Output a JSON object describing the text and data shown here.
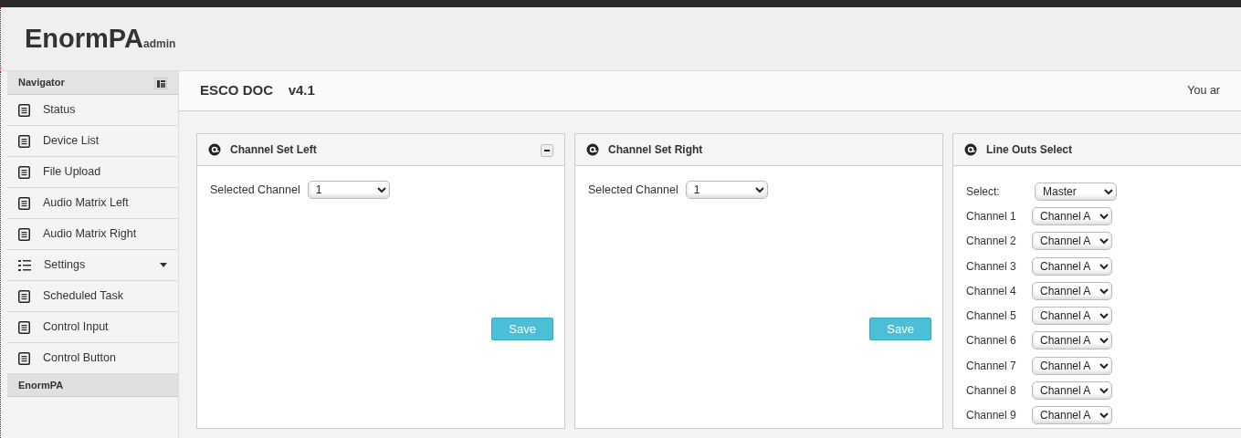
{
  "brand": {
    "name": "EnormPA",
    "suffix": "admin"
  },
  "sidebar": {
    "title": "Navigator",
    "items": [
      {
        "label": "Status",
        "kind": "page"
      },
      {
        "label": "Device List",
        "kind": "page"
      },
      {
        "label": "File Upload",
        "kind": "page"
      },
      {
        "label": "Audio Matrix Left",
        "kind": "page"
      },
      {
        "label": "Audio Matrix Right",
        "kind": "page"
      },
      {
        "label": "Settings",
        "kind": "group",
        "expanded": false
      },
      {
        "label": "Scheduled Task",
        "kind": "page"
      },
      {
        "label": "Control Input",
        "kind": "page"
      },
      {
        "label": "Control Button",
        "kind": "page"
      }
    ],
    "footer": "EnormPA"
  },
  "page": {
    "title": "ESCO DOC",
    "version": "v4.1",
    "user_text": "You ar"
  },
  "panels": [
    {
      "title": "Channel Set Left",
      "collapsible": true,
      "field_label": "Selected Channel",
      "value": "1",
      "save": "Save"
    },
    {
      "title": "Channel Set Right",
      "collapsible": false,
      "field_label": "Selected Channel",
      "value": "1",
      "save": "Save"
    }
  ],
  "line_outs": {
    "title": "Line Outs Select",
    "rows": [
      {
        "label": "Select:",
        "value": "Master"
      },
      {
        "label": "Channel 1",
        "value": "Channel A"
      },
      {
        "label": "Channel 2",
        "value": "Channel A"
      },
      {
        "label": "Channel 3",
        "value": "Channel A"
      },
      {
        "label": "Channel 4",
        "value": "Channel A"
      },
      {
        "label": "Channel 5",
        "value": "Channel A"
      },
      {
        "label": "Channel 6",
        "value": "Channel A"
      },
      {
        "label": "Channel 7",
        "value": "Channel A"
      },
      {
        "label": "Channel 8",
        "value": "Channel A"
      },
      {
        "label": "Channel 9",
        "value": "Channel A"
      }
    ]
  }
}
